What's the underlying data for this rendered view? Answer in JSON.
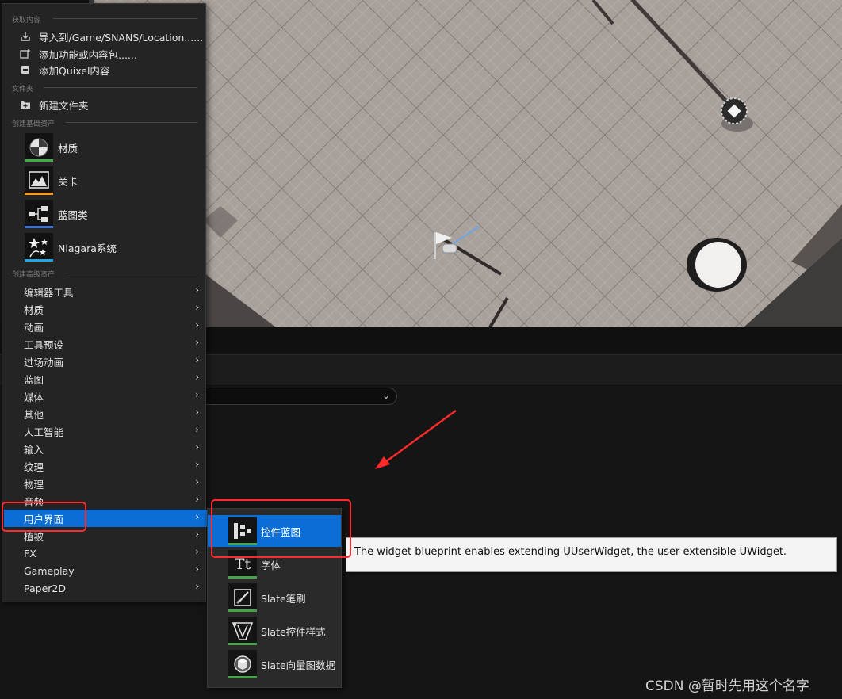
{
  "context_menu": {
    "sections": {
      "get_content": "获取内容",
      "folder": "文件夹",
      "create_basic": "创建基础资产",
      "create_advanced": "创建高级资产"
    },
    "actions": [
      {
        "label": "导入到/Game/SNANS/Location......",
        "icon": "import-icon"
      },
      {
        "label": "添加功能或内容包......",
        "icon": "add-feature-pack-icon"
      },
      {
        "label": "添加Quixel内容",
        "icon": "quixel-icon"
      }
    ],
    "new_folder": {
      "label": "新建文件夹",
      "icon": "new-folder-icon"
    },
    "basic_assets": [
      {
        "label": "材质",
        "icon": "material-sphere-icon",
        "color": "#3fae49"
      },
      {
        "label": "关卡",
        "icon": "level-icon",
        "color": "#f59b1e"
      },
      {
        "label": "蓝图类",
        "icon": "blueprint-class-icon",
        "color": "#3a6fd8"
      },
      {
        "label": "Niagara系统",
        "icon": "niagara-system-icon",
        "color": "#1ea8e6"
      }
    ],
    "advanced_categories": [
      "编辑器工具",
      "材质",
      "动画",
      "工具预设",
      "过场动画",
      "蓝图",
      "媒体",
      "其他",
      "人工智能",
      "输入",
      "纹理",
      "物理",
      "音频",
      "用户界面",
      "植被",
      "FX",
      "Gameplay",
      "Paper2D"
    ],
    "active_category": "用户界面"
  },
  "submenu": {
    "items": [
      {
        "label": "控件蓝图",
        "icon": "widget-blueprint-icon"
      },
      {
        "label": "字体",
        "icon": "font-icon"
      },
      {
        "label": "Slate笔刷",
        "icon": "slate-brush-icon"
      },
      {
        "label": "Slate控件样式",
        "icon": "slate-widget-style-icon"
      },
      {
        "label": "Slate向量图数据",
        "icon": "slate-vector-art-icon"
      }
    ],
    "highlighted": "控件蓝图"
  },
  "tooltip": {
    "text": "The widget blueprint enables extending UUserWidget, the user extensible UWidget."
  },
  "watermark": "CSDN @暂时先用这个名字",
  "colors": {
    "highlight": "#0a6ed6",
    "annotation": "#ff2a2a",
    "menu_bg": "#242424",
    "floor": "#a59c97"
  }
}
